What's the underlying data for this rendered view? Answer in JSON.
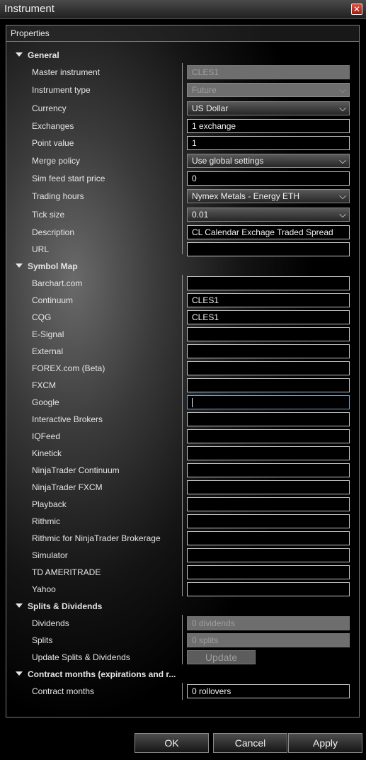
{
  "window": {
    "title": "Instrument"
  },
  "properties_header": "Properties",
  "sections": {
    "general": "General",
    "symbol_map": "Symbol Map",
    "splits": "Splits & Dividends",
    "contract": "Contract months (expirations and r..."
  },
  "general": {
    "master_instrument": {
      "label": "Master instrument",
      "value": "CLES1"
    },
    "instrument_type": {
      "label": "Instrument type",
      "value": "Future"
    },
    "currency": {
      "label": "Currency",
      "value": "US Dollar"
    },
    "exchanges": {
      "label": "Exchanges",
      "value": "1 exchange"
    },
    "point_value": {
      "label": "Point value",
      "value": "1"
    },
    "merge_policy": {
      "label": "Merge policy",
      "value": "Use global settings"
    },
    "sim_feed": {
      "label": "Sim feed start price",
      "value": "0"
    },
    "trading_hours": {
      "label": "Trading hours",
      "value": "Nymex Metals - Energy ETH"
    },
    "tick_size": {
      "label": "Tick size",
      "value": "0.01"
    },
    "description": {
      "label": "Description",
      "value": "CL Calendar Exchage Traded Spread"
    },
    "url": {
      "label": "URL",
      "value": ""
    }
  },
  "symbol_map": [
    {
      "label": "Barchart.com",
      "value": ""
    },
    {
      "label": "Continuum",
      "value": "CLES1"
    },
    {
      "label": "CQG",
      "value": "CLES1"
    },
    {
      "label": "E-Signal",
      "value": ""
    },
    {
      "label": "External",
      "value": ""
    },
    {
      "label": "FOREX.com (Beta)",
      "value": ""
    },
    {
      "label": "FXCM",
      "value": ""
    },
    {
      "label": "Google",
      "value": ""
    },
    {
      "label": "Interactive Brokers",
      "value": ""
    },
    {
      "label": "IQFeed",
      "value": ""
    },
    {
      "label": "Kinetick",
      "value": ""
    },
    {
      "label": "NinjaTrader Continuum",
      "value": ""
    },
    {
      "label": "NinjaTrader FXCM",
      "value": ""
    },
    {
      "label": "Playback",
      "value": ""
    },
    {
      "label": "Rithmic",
      "value": ""
    },
    {
      "label": "Rithmic for NinjaTrader Brokerage",
      "value": ""
    },
    {
      "label": "Simulator",
      "value": ""
    },
    {
      "label": "TD AMERITRADE",
      "value": ""
    },
    {
      "label": "Yahoo",
      "value": ""
    }
  ],
  "splits": {
    "dividends": {
      "label": "Dividends",
      "value": "0 dividends"
    },
    "splits": {
      "label": "Splits",
      "value": "0 splits"
    },
    "update": {
      "label": "Update Splits & Dividends",
      "button": "Update"
    }
  },
  "contract": {
    "months": {
      "label": "Contract months",
      "value": "0 rollovers"
    }
  },
  "buttons": {
    "ok": "OK",
    "cancel": "Cancel",
    "apply": "Apply"
  }
}
